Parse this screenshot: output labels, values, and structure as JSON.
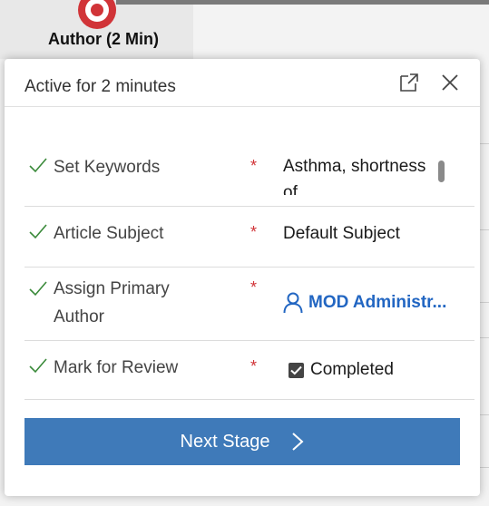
{
  "stage": {
    "title": "Author  (2 Min)"
  },
  "flyout": {
    "header": "Active for 2 minutes",
    "steps": [
      {
        "label": "Set Keywords",
        "value": "Asthma, shortness of",
        "required": "*"
      },
      {
        "label": "Article Subject",
        "value": "Default Subject",
        "required": "*"
      },
      {
        "label": "Assign Primary Author",
        "value": "MOD Administr...",
        "required": "*"
      },
      {
        "label": "Mark for Review",
        "value": "Completed",
        "required": "*"
      }
    ],
    "next_button": "Next Stage"
  },
  "colors": {
    "accent": "#3f7ab9",
    "stage_marker": "#d13438",
    "required": "#d13438",
    "link": "#2266c2"
  },
  "icons": [
    "popout-icon",
    "close-icon",
    "checkmark-icon",
    "user-icon",
    "checkbox-icon",
    "chevron-right-icon"
  ]
}
